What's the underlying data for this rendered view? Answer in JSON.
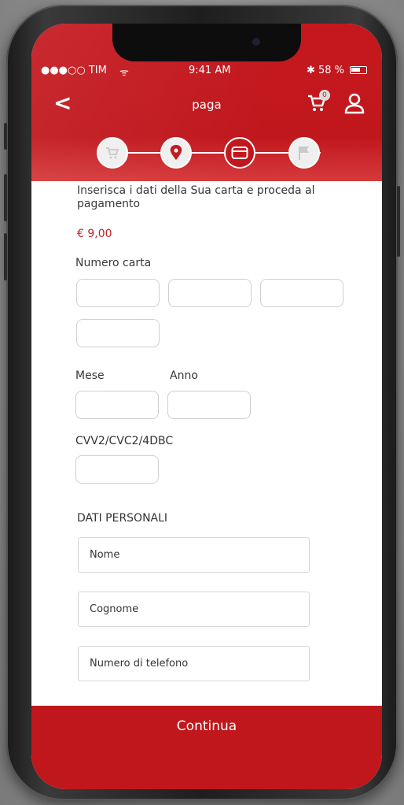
{
  "status_bar": {
    "carrier": "●●●○○ TIM",
    "wifi": "ᯤ",
    "time": "9:41 AM",
    "battery_text": "58 %"
  },
  "nav": {
    "back_icon": "<",
    "title": "paga",
    "cart_badge": "0"
  },
  "steps": [
    {
      "name": "cart-icon",
      "state": "done"
    },
    {
      "name": "location-pin-icon",
      "state": "done"
    },
    {
      "name": "credit-card-icon",
      "state": "active"
    },
    {
      "name": "flag-icon",
      "state": "pending"
    }
  ],
  "form": {
    "intro": "Inserisca i dati della Sua carta e proceda al pagamento",
    "price": "€ 9,00",
    "card_number_label": "Numero carta",
    "month_label": "Mese",
    "year_label": "Anno",
    "cvv_label": "CVV2/CVC2/4DBC",
    "personal_section": "DATI PERSONALI",
    "name_placeholder": "Nome",
    "surname_placeholder": "Cognome",
    "phone_placeholder": "Numero di telefono"
  },
  "footer": {
    "continue_label": "Continua"
  },
  "colors": {
    "brand_red": "#c0171d",
    "header_gradient_end": "#d63a3c"
  }
}
